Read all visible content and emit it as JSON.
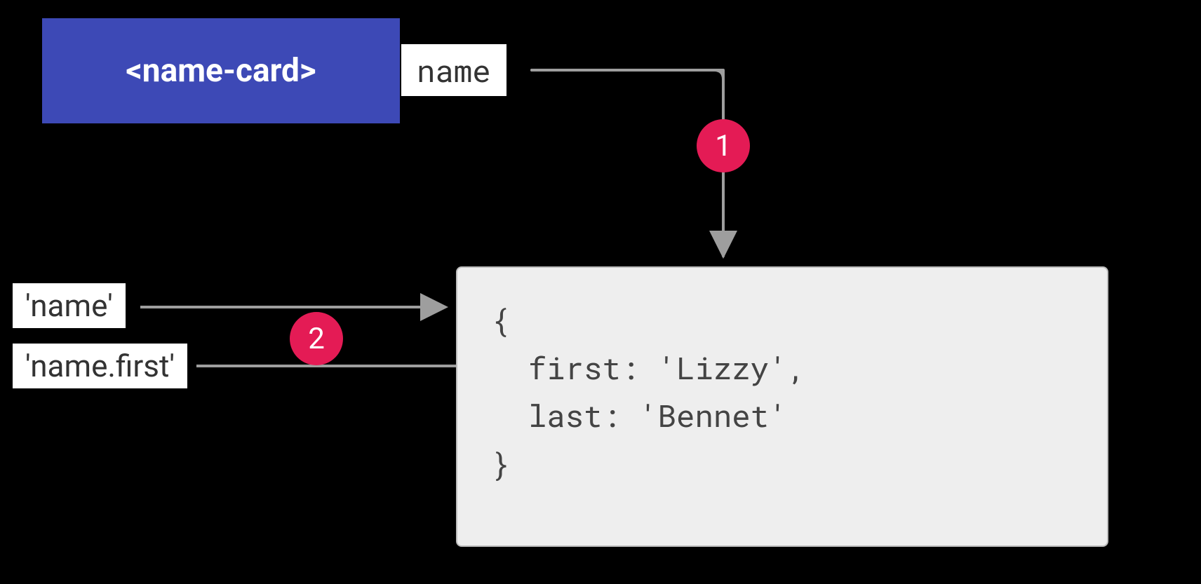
{
  "element_tag": "<name-card>",
  "property_label": "name",
  "paths": {
    "path1": "'name'",
    "path2": "'name.first'"
  },
  "object_lines": {
    "l1": "{",
    "l2": "  first: 'Lizzy',",
    "l3": "  last: 'Bennet'",
    "l4": "}"
  },
  "badges": {
    "b1": "1",
    "b2": "2"
  },
  "colors": {
    "element_bg": "#3d49b6",
    "badge_bg": "#e41b55",
    "object_bg": "#eeeeee",
    "object_border": "#bdbdbd",
    "arrow": "#9e9e9e"
  }
}
